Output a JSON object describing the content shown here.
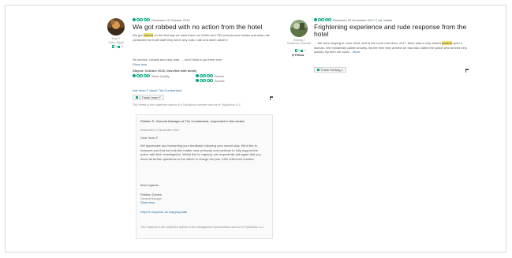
{
  "review1": {
    "reviewer": {
      "name": "Iman F",
      "location": "Cairo, Egypt",
      "contributions": "5",
      "helpful": "4"
    },
    "rating_bubbles": 1,
    "date": "Reviewed 10 October 2016",
    "title": "We got robbed with no action from the hotel",
    "text_before": "We got ",
    "text_hl": "robbed",
    "text_after": " on the first day we went there our Rolex and 750 pounds were stolen and when we contacted the hotel staff they were very cold, rude and didn't admit it.",
    "text2": "No service, Unsafe and very rude .... don't think to go there ever",
    "show_less": "Show less",
    "stayed": "Stayed: October 2016, travelled with family",
    "ratings": [
      {
        "label": "Sleep Quality",
        "bubbles": 1
      },
      {
        "label": "Rooms",
        "bubbles": 1
      },
      {
        "label": "Service",
        "bubbles": 1
      }
    ],
    "ask": "Ask Iman F about The Cumberland",
    "thank": "1  Thank Iman F",
    "disclaimer": "This review is the subjective opinion of a TripAdvisor member and not of TripAdvisor LLC",
    "response": {
      "header": "Riddian D, General Manager at The Cumberland, responded to this review",
      "date": "Responded 14 November 2016",
      "greeting": "Dear Iman F,",
      "body": "We appreciate you forwarding your feedback following your recent stay. We'd like to reassure you that we took this matter very seriously and continue to fully support the police with their investigation. Whilst this is ongoing, we respectfully ask again that you direct all further questions to the officer in charge via your CAD reference number.",
      "regards": "Best regards,",
      "sign_name": "Riddian Davies",
      "sign_title": "General Manager",
      "show_less": "Show less",
      "report": "Report response as inappropriate",
      "disclaimer": "This response is the subjective opinion of the management representative and not of TripAdvisor LLC"
    }
  },
  "review2": {
    "reviewer": {
      "name": "Hedwig J",
      "location": "Stockholm, Sweden",
      "contributions": "5",
      "helpful": "4"
    },
    "follow": "Follow",
    "rating_bubbles": 1,
    "date": "Reviewed 25 November 2017",
    "via": "via mobile",
    "title": "Frightening experience and rude response from the hotel",
    "text_before": "... We were staying in room 4116, and in the room next door, 4117, there was a very violent ",
    "text_hl": "assault",
    "text_after": " upon a woman. We repeatedly called security. By the time they arrived we had also called the police who arrived very quickly. By then we could...",
    "more": "More",
    "thank": "Thank Hedwig J"
  },
  "colors": {
    "accent": "#00a680",
    "highlight": "#f2e46a",
    "link": "#2a6a9e"
  },
  "icons": [
    "flag-icon",
    "thumbs-up-icon",
    "mobile-icon",
    "review-count-icon",
    "avatar-image"
  ]
}
